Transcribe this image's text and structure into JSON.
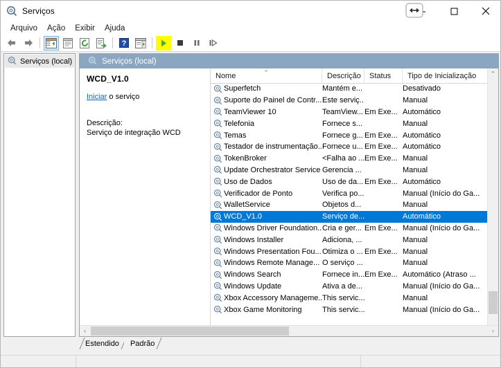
{
  "window": {
    "title": "Serviços",
    "icon": "services-gear-icon",
    "buttons": {
      "minimize": "minimize",
      "maximize": "maximize",
      "close": "close"
    },
    "cursor": "horizontal-resize-cursor"
  },
  "menubar": {
    "items": [
      {
        "label": "Arquivo"
      },
      {
        "label": "Ação"
      },
      {
        "label": "Exibir"
      },
      {
        "label": "Ajuda"
      }
    ]
  },
  "toolbar": {
    "buttons": [
      {
        "name": "back-arrow-icon",
        "kind": "back"
      },
      {
        "name": "forward-arrow-icon",
        "kind": "forward"
      },
      {
        "name": "sep1",
        "kind": "separator"
      },
      {
        "name": "show-hide-console-tree-icon",
        "kind": "tree",
        "active": true
      },
      {
        "name": "properties-icon",
        "kind": "properties"
      },
      {
        "name": "refresh-icon",
        "kind": "refresh"
      },
      {
        "name": "export-list-icon",
        "kind": "export"
      },
      {
        "name": "sep2",
        "kind": "separator"
      },
      {
        "name": "help-icon",
        "kind": "help"
      },
      {
        "name": "show-action-pane-icon",
        "kind": "actionpane"
      },
      {
        "name": "sep3",
        "kind": "separator"
      },
      {
        "name": "start-service-icon",
        "kind": "play",
        "highlighted": true
      },
      {
        "name": "stop-service-icon",
        "kind": "stop"
      },
      {
        "name": "pause-service-icon",
        "kind": "pause"
      },
      {
        "name": "restart-service-icon",
        "kind": "restart"
      }
    ]
  },
  "tree": {
    "items": [
      {
        "label": "Serviços (local)",
        "icon": "services-gear-icon",
        "selected": true
      }
    ]
  },
  "pane": {
    "header": "Serviços (local)",
    "header_icon": "services-gear-icon"
  },
  "detail": {
    "service_name": "WCD_V1.0",
    "action_link": "Iniciar",
    "action_suffix": " o serviço",
    "description_label": "Descrição:",
    "description_text": "Serviço de integração WCD"
  },
  "list": {
    "columns": [
      {
        "label": "Nome",
        "sorted": "asc",
        "sort_caret": "⌃"
      },
      {
        "label": "Descrição"
      },
      {
        "label": "Status"
      },
      {
        "label": "Tipo de Inicialização"
      }
    ],
    "scroll_corner_caret": "⌃",
    "rows": [
      {
        "icon": "service-gear-icon",
        "name": "Superfetch",
        "description": "Mantém e...",
        "status": "",
        "startup": "Desativado",
        "selected": false
      },
      {
        "icon": "service-gear-icon",
        "name": "Suporte do Painel de Contr...",
        "description": "Este serviç...",
        "status": "",
        "startup": "Manual",
        "selected": false
      },
      {
        "icon": "service-gear-icon",
        "name": "TeamViewer 10",
        "description": "TeamView...",
        "status": "Em Exe...",
        "startup": "Automático",
        "selected": false
      },
      {
        "icon": "service-gear-icon",
        "name": "Telefonia",
        "description": "Fornece s...",
        "status": "",
        "startup": "Manual",
        "selected": false
      },
      {
        "icon": "service-gear-icon",
        "name": "Temas",
        "description": "Fornece g...",
        "status": "Em Exe...",
        "startup": "Automático",
        "selected": false
      },
      {
        "icon": "service-gear-icon",
        "name": "Testador de instrumentação...",
        "description": "Fornece u...",
        "status": "Em Exe...",
        "startup": "Automático",
        "selected": false
      },
      {
        "icon": "service-gear-icon",
        "name": "TokenBroker",
        "description": "<Falha ao ...",
        "status": "Em Exe...",
        "startup": "Manual",
        "selected": false
      },
      {
        "icon": "service-gear-icon",
        "name": "Update Orchestrator Service",
        "description": "Gerencia ...",
        "status": "",
        "startup": "Manual",
        "selected": false
      },
      {
        "icon": "service-gear-icon",
        "name": "Uso de Dados",
        "description": "Uso de da...",
        "status": "Em Exe...",
        "startup": "Automático",
        "selected": false
      },
      {
        "icon": "service-gear-icon",
        "name": "Verificador de Ponto",
        "description": "Verifica po...",
        "status": "",
        "startup": "Manual (Início do Ga...",
        "selected": false
      },
      {
        "icon": "service-gear-icon",
        "name": "WalletService",
        "description": "Objetos d...",
        "status": "",
        "startup": "Manual",
        "selected": false
      },
      {
        "icon": "service-gear-icon",
        "name": "WCD_V1.0",
        "description": "Serviço de...",
        "status": "",
        "startup": "Automático",
        "selected": true
      },
      {
        "icon": "service-gear-icon",
        "name": "Windows Driver Foundation...",
        "description": "Cria e ger...",
        "status": "Em Exe...",
        "startup": "Manual (Início do Ga...",
        "selected": false
      },
      {
        "icon": "service-gear-icon",
        "name": "Windows Installer",
        "description": "Adiciona, ...",
        "status": "",
        "startup": "Manual",
        "selected": false
      },
      {
        "icon": "service-gear-icon",
        "name": "Windows Presentation Fou...",
        "description": "Otimiza o ...",
        "status": "Em Exe...",
        "startup": "Manual",
        "selected": false
      },
      {
        "icon": "service-gear-icon",
        "name": "Windows Remote Manage...",
        "description": "O serviço ...",
        "status": "",
        "startup": "Manual",
        "selected": false
      },
      {
        "icon": "service-gear-icon",
        "name": "Windows Search",
        "description": "Fornece in...",
        "status": "Em Exe...",
        "startup": "Automático (Atraso ...",
        "selected": false
      },
      {
        "icon": "service-gear-icon",
        "name": "Windows Update",
        "description": "Ativa a de...",
        "status": "",
        "startup": "Manual (Início do Ga...",
        "selected": false
      },
      {
        "icon": "service-gear-icon",
        "name": "Xbox Accessory Manageme...",
        "description": "This servic...",
        "status": "",
        "startup": "Manual",
        "selected": false
      },
      {
        "icon": "service-gear-icon",
        "name": "Xbox Game Monitoring",
        "description": "This servic...",
        "status": "",
        "startup": "Manual (Início do Ga...",
        "selected": false
      }
    ]
  },
  "scrollbars": {
    "vertical_up_caret": "⌃",
    "vertical_down_caret": "⌄",
    "horizontal_left_caret": "‹",
    "horizontal_right_caret": "›"
  },
  "tabs": [
    {
      "label": "Estendido",
      "active": false
    },
    {
      "label": "Padrão",
      "active": true
    }
  ],
  "colors": {
    "selection_blue": "#0078d7",
    "pane_header_blue": "#8aa6c0",
    "link_blue": "#0066cc",
    "toolbar_highlight_yellow": "#ffff00",
    "play_green": "#3faa3f"
  }
}
